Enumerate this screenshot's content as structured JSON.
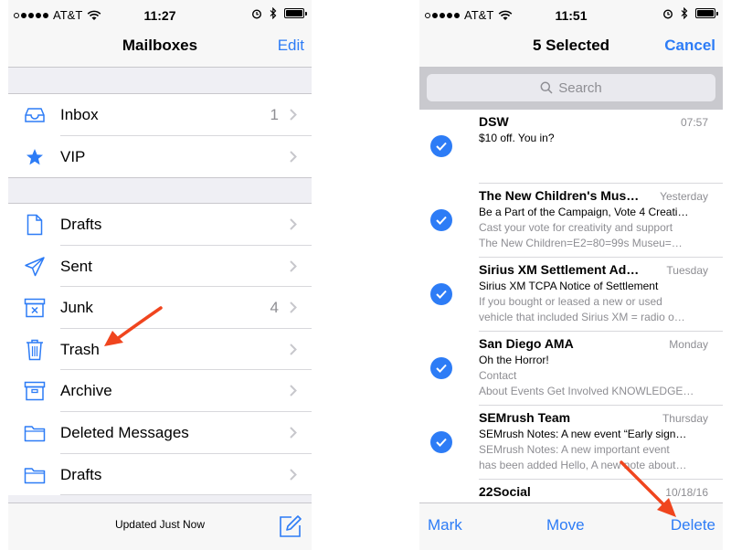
{
  "left": {
    "status": {
      "carrier": "AT&T",
      "time": "11:27"
    },
    "nav": {
      "title": "Mailboxes",
      "edit_label": "Edit"
    },
    "groups": [
      [
        {
          "label": "Inbox",
          "count": "1",
          "icon": "inbox-icon"
        },
        {
          "label": "VIP",
          "count": "",
          "icon": "star-icon"
        }
      ],
      [
        {
          "label": "Drafts",
          "count": "",
          "icon": "document-icon"
        },
        {
          "label": "Sent",
          "count": "",
          "icon": "paper-plane-icon"
        },
        {
          "label": "Junk",
          "count": "4",
          "icon": "junk-box-icon"
        },
        {
          "label": "Trash",
          "count": "",
          "icon": "trash-icon"
        },
        {
          "label": "Archive",
          "count": "",
          "icon": "archive-box-icon"
        },
        {
          "label": "Deleted Messages",
          "count": "",
          "icon": "folder-icon"
        },
        {
          "label": "Drafts",
          "count": "",
          "icon": "folder-icon"
        }
      ]
    ],
    "toolbar": {
      "status": "Updated Just Now"
    }
  },
  "right": {
    "status": {
      "carrier": "AT&T",
      "time": "11:51"
    },
    "nav": {
      "title": "5 Selected",
      "cancel_label": "Cancel"
    },
    "search": {
      "placeholder": "Search"
    },
    "messages": [
      {
        "sender": "DSW",
        "date": "07:57",
        "subject": "$10 off. You in?",
        "preview": [
          "",
          ""
        ],
        "selected": true
      },
      {
        "sender": "The New Children's Mus…",
        "date": "Yesterday",
        "subject": "Be a Part of the Campaign, Vote 4 Creati…",
        "preview": [
          "Cast your vote for creativity and support",
          "The New Children=E2=80=99s Museu=…"
        ],
        "selected": true
      },
      {
        "sender": "Sirius XM Settlement Ad…",
        "date": "Tuesday",
        "subject": "Sirius XM TCPA Notice of Settlement",
        "preview": [
          "If you bought or leased a new or used",
          "vehicle that included Sirius XM = radio o…"
        ],
        "selected": true
      },
      {
        "sender": "San Diego AMA",
        "date": "Monday",
        "subject": "Oh the Horror!",
        "preview": [
          "Contact",
          "About Events Get Involved KNOWLEDGE…"
        ],
        "selected": true
      },
      {
        "sender": "SEMrush Team",
        "date": "Thursday",
        "subject": "SEMrush Notes: A new event “Early sign…",
        "preview": [
          "SEMrush Notes: A new important event",
          "has been added Hello, A new note about…"
        ],
        "selected": true
      },
      {
        "sender": "22Social",
        "date": "10/18/16",
        "subject": "",
        "preview": [
          "",
          ""
        ],
        "selected": false
      }
    ],
    "toolbar": {
      "mark_label": "Mark",
      "move_label": "Move",
      "delete_label": "Delete"
    }
  },
  "colors": {
    "accent": "#2d7cf6",
    "annotation_arrow": "#f0451e"
  }
}
